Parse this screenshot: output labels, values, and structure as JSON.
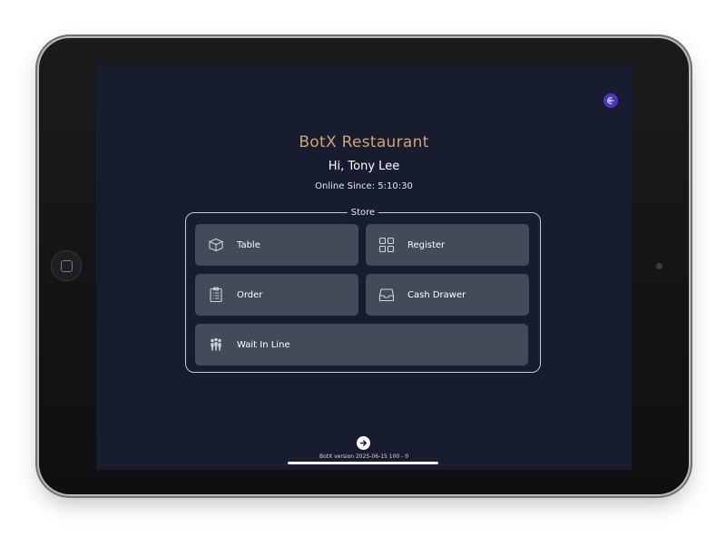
{
  "app": {
    "brand": "BotX Restaurant",
    "greeting": "Hi, Tony Lee",
    "online_label": "Online Since:",
    "online_time": "5:10:30"
  },
  "store": {
    "legend": "Store",
    "tiles": [
      {
        "label": "Table",
        "icon": "box-icon"
      },
      {
        "label": "Register",
        "icon": "grid-icon"
      },
      {
        "label": "Order",
        "icon": "clipboard-icon"
      },
      {
        "label": "Cash Drawer",
        "icon": "inbox-tray-icon"
      },
      {
        "label": "Wait In Line",
        "icon": "people-icon"
      }
    ]
  },
  "footer": {
    "version": "BotX version 2025-06-15 100 - 0"
  },
  "colors": {
    "screen_bg": "#171d2f",
    "tile_bg": "#434a58",
    "brand": "#d4a273",
    "accent": "#4f33c9"
  }
}
